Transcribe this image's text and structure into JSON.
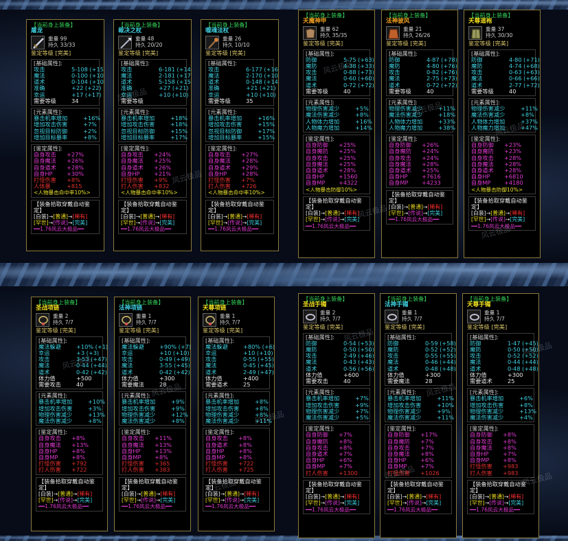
{
  "header_label": "【当前身上装备】",
  "grade_label": "鉴定等级",
  "grade_value": "[完美]",
  "base_title": "[基础属性]:",
  "elem_title": "[元素属性]:",
  "appr_title": "[鉴定属性]:",
  "weight_label": "重量",
  "dura_label": "持久",
  "bind_title": "【装备拾取穿戴自动鉴定】",
  "bind_chain1": [
    "[白装]",
    "→",
    "[普通]",
    "→",
    "[稀有]"
  ],
  "bind_chain2": [
    "[罕世]",
    "→",
    "[传说]",
    "→",
    "[完美]"
  ],
  "footer": "━━1.76风云大极品━━",
  "watermark": "风云极品",
  "panels": [
    {
      "name": "屠龙",
      "name_color": "cyan",
      "icon": "sword-icon",
      "weight": "99",
      "dura": "33/33",
      "base": [
        {
          "k": "攻击",
          "v": "5-108 (+153)"
        },
        {
          "k": "魔法",
          "v": "0-100 (+104)"
        },
        {
          "k": "道术",
          "v": "0-104 (+104)"
        },
        {
          "k": "准确",
          "v": "+22 (+22)"
        },
        {
          "k": "幸运",
          "v": "+17 (+17)"
        },
        {
          "k": "需要等级",
          "v": "34",
          "white": true
        }
      ],
      "elem": [
        {
          "k": "暴击机率增加",
          "v": "+16%"
        },
        {
          "k": "增加攻击伤害",
          "v": "+7%"
        },
        {
          "k": "忽视目标防御",
          "v": "+2%"
        },
        {
          "k": "增加目标暴率",
          "v": "+8%"
        }
      ],
      "appr": [
        {
          "k": "自身攻击",
          "v": "+27%"
        },
        {
          "k": "自身魔法",
          "v": "+26%"
        },
        {
          "k": "自身道术",
          "v": "+28%"
        },
        {
          "k": "自身HP",
          "v": "+30%"
        },
        {
          "k": "打怪伤害",
          "v": "+8%",
          "red": true
        },
        {
          "k": "人体暴",
          "v": "+815",
          "red": true
        }
      ],
      "note": "<人物暴击命中率10%>"
    },
    {
      "name": "裁决之杖",
      "name_color": "cyan",
      "icon": "staff-icon",
      "weight": "48",
      "dura": "20/20",
      "base": [
        {
          "k": "攻击",
          "v": "6-181 (+149)"
        },
        {
          "k": "魔法",
          "v": "2-181 (+174)"
        },
        {
          "k": "道术",
          "v": "5-158 (+158)"
        },
        {
          "k": "准确",
          "v": "+27 (+21)"
        },
        {
          "k": "幸运",
          "v": "+10 (+10)"
        },
        {
          "k": "需要等级",
          "v": "",
          "white": true
        }
      ],
      "elem": [
        {
          "k": "暴击机率增加",
          "v": "+18%"
        },
        {
          "k": "增加攻击伤害",
          "v": "+18%"
        },
        {
          "k": "忽视目标防御",
          "v": "+15%"
        },
        {
          "k": "增加目标暴率",
          "v": "+17%"
        }
      ],
      "appr": [
        {
          "k": "自身攻击",
          "v": "+24%"
        },
        {
          "k": "自身魔法",
          "v": "+25%"
        },
        {
          "k": "自身道术",
          "v": "+26%"
        },
        {
          "k": "自身HP",
          "v": "+21%"
        },
        {
          "k": "打怪伤害",
          "v": "+9%",
          "red": true
        },
        {
          "k": "打人伤害",
          "v": "+832",
          "red": true
        }
      ],
      "note": "<人物暴击命中率10%>"
    },
    {
      "name": "噬魂法杖",
      "name_color": "cyan",
      "icon": "wand-icon",
      "weight": "26",
      "dura": "10/10",
      "base": [
        {
          "k": "攻击",
          "v": "6-177 (+164)"
        },
        {
          "k": "魔法",
          "v": "2-170 (+102)"
        },
        {
          "k": "道术",
          "v": "0-148 (+148)"
        },
        {
          "k": "准确",
          "v": "+21 (+21)"
        },
        {
          "k": "幸运",
          "v": "+10 (+10)"
        },
        {
          "k": "需要等级",
          "v": "35",
          "white": true
        }
      ],
      "elem": [
        {
          "k": "暴击机率增加",
          "v": "+16%"
        },
        {
          "k": "增加攻击伤害",
          "v": "+15%"
        },
        {
          "k": "忽视目标防御",
          "v": "+17%"
        },
        {
          "k": "增加目标暴率",
          "v": "+15%"
        }
      ],
      "appr": [
        {
          "k": "自身攻击",
          "v": "+27%"
        },
        {
          "k": "自身魔法",
          "v": "+28%"
        },
        {
          "k": "自身道术",
          "v": "+29%"
        },
        {
          "k": "自身HP",
          "v": "+28%"
        },
        {
          "k": "打怪伤害",
          "v": "+7%",
          "red": true
        },
        {
          "k": "打人伤害",
          "v": "+726",
          "red": true
        }
      ],
      "note": "<人物暴击命中率10%>"
    },
    {
      "name": "天魔神甲",
      "name_color": "orange",
      "icon": "armor-icon",
      "weight": "62",
      "dura": "35/35",
      "base": [
        {
          "k": "防御",
          "v": "5-75 (+63)"
        },
        {
          "k": "魔防",
          "v": "4-38 (+33)"
        },
        {
          "k": "攻击",
          "v": "0-88 (+73)"
        },
        {
          "k": "魔法",
          "v": "0-60 (+60)"
        },
        {
          "k": "道术",
          "v": "0-72 (+72)"
        },
        {
          "k": "需要等级",
          "v": "40",
          "white": true
        }
      ],
      "elem": [
        {
          "k": "物理伤害减少",
          "v": "+5%"
        },
        {
          "k": "魔法伤害减少",
          "v": "+8%"
        },
        {
          "k": "人物体力增加",
          "v": "+16%"
        },
        {
          "k": "人物魔力增加",
          "v": "+14%"
        }
      ],
      "appr": [
        {
          "k": "自身防御",
          "v": "+25%"
        },
        {
          "k": "自身魔防",
          "v": "+25%"
        },
        {
          "k": "自身攻击",
          "v": "+25%"
        },
        {
          "k": "自身魔法",
          "v": "+25%"
        },
        {
          "k": "自身道术",
          "v": "+28%"
        },
        {
          "k": "自身HP",
          "v": "+1560"
        },
        {
          "k": "自身MP",
          "v": "+4322"
        }
      ],
      "note": "<人物暴击防御10%>"
    },
    {
      "name": "法神披风",
      "name_color": "orange",
      "icon": "cloak-icon",
      "weight": "21",
      "dura": "26/26",
      "base": [
        {
          "k": "防御",
          "v": "4-87 (+78)"
        },
        {
          "k": "魔防",
          "v": "4-80 (+76)"
        },
        {
          "k": "攻击",
          "v": "0-82 (+76)"
        },
        {
          "k": "魔法",
          "v": "2-75 (+73)"
        },
        {
          "k": "道术",
          "v": "0-72 (+72)"
        },
        {
          "k": "需要等级",
          "v": "40",
          "white": true
        }
      ],
      "elem": [
        {
          "k": "物理伤害减少",
          "v": "+11%"
        },
        {
          "k": "魔法伤害减少",
          "v": "+18%"
        },
        {
          "k": "人物体力增加",
          "v": "+33%"
        },
        {
          "k": "人物魔力增加",
          "v": "+38%"
        }
      ],
      "appr": [
        {
          "k": "自身防御",
          "v": "+26%"
        },
        {
          "k": "自身魔防",
          "v": "+24%"
        },
        {
          "k": "自身攻击",
          "v": "+24%"
        },
        {
          "k": "自身魔法",
          "v": "+28%"
        },
        {
          "k": "自身道术",
          "v": "+25%"
        },
        {
          "k": "自身HP",
          "v": "+7616"
        },
        {
          "k": "自身MP",
          "v": "+4233"
        }
      ],
      "note": ""
    },
    {
      "name": "天尊道袍",
      "name_color": "yellow",
      "icon": "robe-icon",
      "weight": "37",
      "dura": "30/30",
      "base": [
        {
          "k": "防御",
          "v": "4-80 (+71)"
        },
        {
          "k": "魔防",
          "v": "4-74 (+68)"
        },
        {
          "k": "攻击",
          "v": "0-63 (+63)"
        },
        {
          "k": "魔法",
          "v": "0-66 (+66)"
        },
        {
          "k": "道术",
          "v": "2-77 (+72)"
        },
        {
          "k": "需要等级",
          "v": "40",
          "white": true
        }
      ],
      "elem": [
        {
          "k": "物理伤害减少",
          "v": "+11%"
        },
        {
          "k": "魔法伤害减少",
          "v": "+8%"
        },
        {
          "k": "人物体力增加",
          "v": "+37%"
        },
        {
          "k": "人物魔力增加",
          "v": "+47%"
        }
      ],
      "appr": [
        {
          "k": "自身防御",
          "v": "+23%"
        },
        {
          "k": "自身魔防",
          "v": "+23%"
        },
        {
          "k": "自身攻击",
          "v": "+28%"
        },
        {
          "k": "自身魔法",
          "v": "+28%"
        },
        {
          "k": "自身道术",
          "v": "+28%"
        },
        {
          "k": "自身HP",
          "v": "+6810"
        },
        {
          "k": "自身MP",
          "v": "+4180"
        }
      ],
      "note": "<人物暴击防御10%>"
    },
    {
      "name": "圣战项链",
      "name_color": "yellow",
      "icon": "necklace-icon",
      "weight": "2",
      "dura": "7/7",
      "base": [
        {
          "k": "魔法躲避",
          "v": "+10% (+1)"
        },
        {
          "k": "幸运",
          "v": "+3 (+3)"
        },
        {
          "k": "攻击",
          "v": "3-53 (+47)"
        },
        {
          "k": "魔法",
          "v": "0-44 (+44)"
        },
        {
          "k": "道术",
          "v": "0-42 (+42)"
        },
        {
          "k": "体力值",
          "v": "+500",
          "white": true
        },
        {
          "k": "需要攻击",
          "v": "40",
          "white": true
        }
      ],
      "elem": [
        {
          "k": "暴击机率增加",
          "v": "+10%"
        },
        {
          "k": "增加攻击伤害",
          "v": "+3%"
        },
        {
          "k": "物理伤害减少",
          "v": "+13%"
        },
        {
          "k": "魔法伤害减少",
          "v": "+8%"
        }
      ],
      "appr": [
        {
          "k": "自身攻击",
          "v": "+8%"
        },
        {
          "k": "自身魔法",
          "v": "+13%"
        },
        {
          "k": "自身HP",
          "v": "+8%"
        },
        {
          "k": "自身MP",
          "v": "+8%"
        },
        {
          "k": "打怪伤害",
          "v": "+792",
          "red": true
        },
        {
          "k": "打人伤害",
          "v": "+722",
          "red": true
        }
      ],
      "note": ""
    },
    {
      "name": "法神项链",
      "name_color": "cyan",
      "icon": "necklace-icon",
      "weight": "1",
      "dura": "7/7",
      "base": [
        {
          "k": "魔法躲避",
          "v": "+90% (+7)"
        },
        {
          "k": "幸运",
          "v": "+10 (+10)"
        },
        {
          "k": "攻击",
          "v": "0-49 (+49)"
        },
        {
          "k": "魔法",
          "v": "3-55 (+45)"
        },
        {
          "k": "道术",
          "v": "0-42 (+42)"
        },
        {
          "k": "体力值",
          "v": "+300",
          "white": true
        },
        {
          "k": "需要魔法",
          "v": "28",
          "white": true
        }
      ],
      "elem": [
        {
          "k": "暴击机率增加",
          "v": "+9%"
        },
        {
          "k": "增加攻击伤害",
          "v": "+9%"
        },
        {
          "k": "物理伤害减少",
          "v": "+12%"
        },
        {
          "k": "魔法伤害减少",
          "v": "+8%"
        }
      ],
      "appr": [
        {
          "k": "自身攻击",
          "v": "+11%"
        },
        {
          "k": "自身魔法",
          "v": "+13%"
        },
        {
          "k": "自身HP",
          "v": "+13%"
        },
        {
          "k": "自身MP",
          "v": "+8%"
        },
        {
          "k": "打怪伤害",
          "v": "+365",
          "red": true
        },
        {
          "k": "打人伤害",
          "v": "+383",
          "red": true
        }
      ],
      "note": ""
    },
    {
      "name": "天尊项链",
      "name_color": "yellow",
      "icon": "necklace-icon",
      "weight": "1",
      "dura": "7/7",
      "base": [
        {
          "k": "魔法躲避",
          "v": "+80% (+6)"
        },
        {
          "k": "幸运",
          "v": "+10 (+10)"
        },
        {
          "k": "攻击",
          "v": "0-55 (+55)"
        },
        {
          "k": "魔法",
          "v": "0-45 (+45)"
        },
        {
          "k": "道术",
          "v": "2-49 (+47)"
        },
        {
          "k": "体力值",
          "v": "+400",
          "white": true
        },
        {
          "k": "需要道术",
          "v": "25",
          "white": true
        }
      ],
      "elem": [
        {
          "k": "暴击机率增加",
          "v": "+8%"
        },
        {
          "k": "增加攻击伤害",
          "v": "+8%"
        },
        {
          "k": "物理伤害减少",
          "v": "+8%"
        },
        {
          "k": "魔法伤害减少",
          "v": "+11%"
        }
      ],
      "appr": [
        {
          "k": "自身攻击",
          "v": "+8%"
        },
        {
          "k": "自身道术",
          "v": "+8%"
        },
        {
          "k": "自身HP",
          "v": "+8%"
        },
        {
          "k": "自身MP",
          "v": "+8%"
        },
        {
          "k": "打怪伤害",
          "v": "+722",
          "red": true
        },
        {
          "k": "打人伤害",
          "v": "+725",
          "red": true
        }
      ],
      "note": ""
    },
    {
      "name": "圣战手镯",
      "name_color": "yellow",
      "icon": "bracelet-icon",
      "weight": "2",
      "dura": "7/7",
      "base": [
        {
          "k": "防御",
          "v": "0-54 (+53)"
        },
        {
          "k": "魔防",
          "v": "0-50 (+50)"
        },
        {
          "k": "攻击",
          "v": "2-49 (+46)"
        },
        {
          "k": "魔法",
          "v": "0-43 (+43)"
        },
        {
          "k": "道术",
          "v": "0-56 (+56)"
        },
        {
          "k": "体力值",
          "v": "+600",
          "white": true
        },
        {
          "k": "需要攻击",
          "v": "40",
          "white": true
        }
      ],
      "elem": [
        {
          "k": "暴击机率增加",
          "v": "+7%"
        },
        {
          "k": "增加攻击伤害",
          "v": "+9%"
        },
        {
          "k": "物理伤害减少",
          "v": "+7%"
        },
        {
          "k": "魔法伤害减少",
          "v": "+5%"
        }
      ],
      "appr": [
        {
          "k": "自身防御",
          "v": "+7%"
        },
        {
          "k": "自身魔防",
          "v": "+8%"
        },
        {
          "k": "自身攻击",
          "v": "+8%"
        },
        {
          "k": "自身道术",
          "v": "+7%"
        },
        {
          "k": "自身HP",
          "v": "+6%"
        },
        {
          "k": "自身MP",
          "v": "+7%"
        },
        {
          "k": "打人伤害",
          "v": "+1300",
          "red": true
        }
      ],
      "note": ""
    },
    {
      "name": "法神手镯",
      "name_color": "cyan",
      "icon": "bracelet-icon",
      "weight": "1",
      "dura": "7/7",
      "base": [
        {
          "k": "防御",
          "v": "0-59 (+58)"
        },
        {
          "k": "魔防",
          "v": "0-52 (+52)"
        },
        {
          "k": "攻击",
          "v": "0-55 (+55)"
        },
        {
          "k": "魔法",
          "v": "0-46 (+44)"
        },
        {
          "k": "道术",
          "v": "0-48 (+48)"
        },
        {
          "k": "体力值",
          "v": "+300",
          "white": true
        },
        {
          "k": "需要魔法",
          "v": "28",
          "white": true
        }
      ],
      "elem": [
        {
          "k": "暴击机率增加",
          "v": "+11%"
        },
        {
          "k": "增加攻击伤害",
          "v": "+10%"
        },
        {
          "k": "物理伤害减少",
          "v": "+9%"
        },
        {
          "k": "魔法伤害减少",
          "v": "+11%"
        }
      ],
      "appr": [
        {
          "k": "自身防御",
          "v": "+17%"
        },
        {
          "k": "自身魔防",
          "v": "+7%"
        },
        {
          "k": "自身攻击",
          "v": "+7%"
        },
        {
          "k": "自身魔法",
          "v": "+8%"
        },
        {
          "k": "自身HP",
          "v": "+6%"
        },
        {
          "k": "自身MP",
          "v": "+7%"
        },
        {
          "k": "打怪伤害",
          "v": "+1026",
          "red": true
        }
      ],
      "note": ""
    },
    {
      "name": "天尊手镯",
      "name_color": "yellow",
      "icon": "bracelet-icon",
      "weight": "1",
      "dura": "7/7",
      "base": [
        {
          "k": "防御",
          "v": "1-47 (+45)"
        },
        {
          "k": "魔防",
          "v": "0-50 (+50)"
        },
        {
          "k": "攻击",
          "v": "0-52 (+52)"
        },
        {
          "k": "魔法",
          "v": "0-44 (+44)"
        },
        {
          "k": "道术",
          "v": "0-48 (+48)"
        },
        {
          "k": "体力值",
          "v": "+300",
          "white": true
        },
        {
          "k": "需要道术",
          "v": "25",
          "white": true
        }
      ],
      "elem": [
        {
          "k": "暴击机率增加",
          "v": "+6%"
        },
        {
          "k": "增加攻击伤害",
          "v": "+8%"
        },
        {
          "k": "物理伤害减少",
          "v": "+13%"
        },
        {
          "k": "魔法伤害减少",
          "v": "+4%"
        }
      ],
      "appr": [
        {
          "k": "自身防御",
          "v": "+8%"
        },
        {
          "k": "自身攻击",
          "v": "+8%"
        },
        {
          "k": "自身魔法",
          "v": "+8%"
        },
        {
          "k": "自身HP",
          "v": "+7%"
        },
        {
          "k": "自身MP",
          "v": "+8%"
        },
        {
          "k": "打怪伤害",
          "v": "+983",
          "red": true
        },
        {
          "k": "打人伤害",
          "v": "+983",
          "red": true
        }
      ],
      "note": ""
    }
  ]
}
